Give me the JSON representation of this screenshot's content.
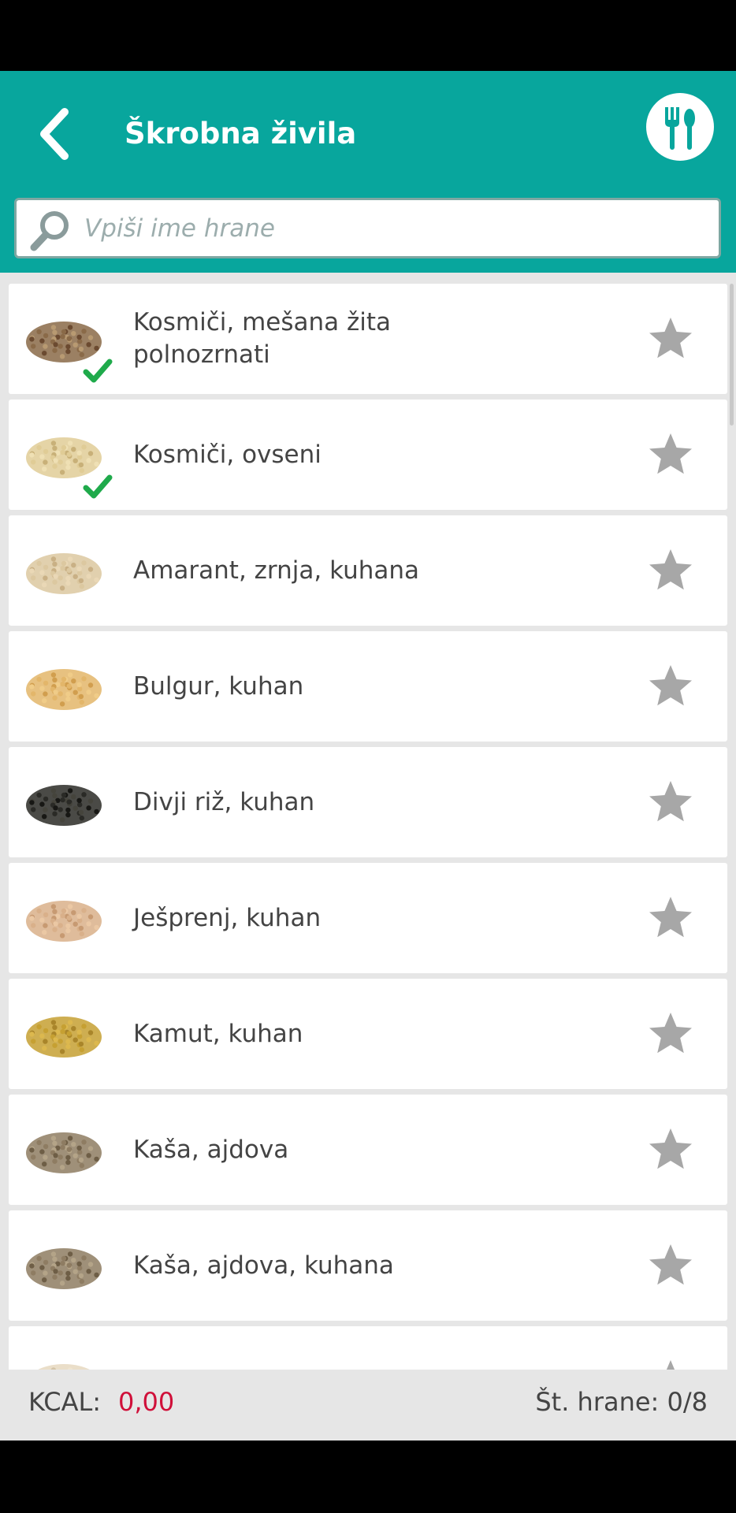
{
  "header": {
    "title": "Škrobna živila",
    "back_icon": "chevron-left-icon",
    "meal_icon": "fork-spoon-icon",
    "bg_color": "#08a69d"
  },
  "search": {
    "placeholder": "Vpiši ime hrane",
    "value": "",
    "icon": "search-icon"
  },
  "foods": [
    {
      "name": "Kosmiči, mešana žita polnozrnati",
      "selected": true,
      "favorite": false,
      "swatch": "grain-mix"
    },
    {
      "name": "Kosmiči, ovseni",
      "selected": true,
      "favorite": false,
      "swatch": "oat"
    },
    {
      "name": "Amarant, zrnja, kuhana",
      "selected": false,
      "favorite": false,
      "swatch": "amaranth"
    },
    {
      "name": "Bulgur, kuhan",
      "selected": false,
      "favorite": false,
      "swatch": "bulgur"
    },
    {
      "name": "Divji riž, kuhan",
      "selected": false,
      "favorite": false,
      "swatch": "wild-rice"
    },
    {
      "name": "Ješprenj, kuhan",
      "selected": false,
      "favorite": false,
      "swatch": "barley"
    },
    {
      "name": "Kamut, kuhan",
      "selected": false,
      "favorite": false,
      "swatch": "kamut"
    },
    {
      "name": "Kaša, ajdova",
      "selected": false,
      "favorite": false,
      "swatch": "buckwheat"
    },
    {
      "name": "Kaša, ajdova, kuhana",
      "selected": false,
      "favorite": false,
      "swatch": "buckwheat"
    },
    {
      "name": "",
      "selected": false,
      "favorite": false,
      "swatch": "partial"
    }
  ],
  "footer": {
    "kcal_label": "KCAL:",
    "kcal_value": "0,00",
    "count_label": "Št. hrane: 0/8",
    "kcal_color": "#d0103a"
  }
}
